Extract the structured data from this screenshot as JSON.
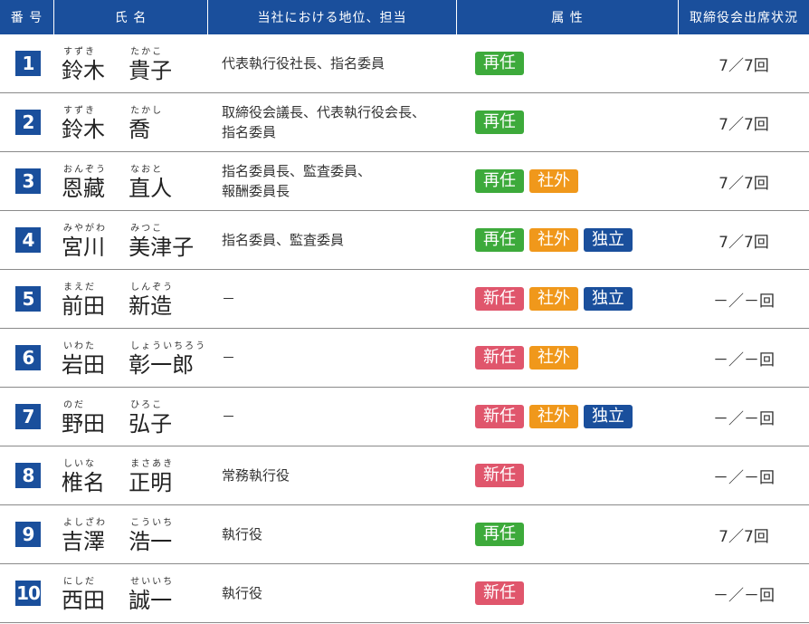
{
  "header": {
    "number": "番 号",
    "name": "氏 名",
    "position": "当社における地位、担当",
    "attributes": "属 性",
    "attendance": "取締役会出席状況"
  },
  "tag_colors": {
    "再任": "#3daa3b",
    "新任": "#e0566c",
    "社外": "#f0981b",
    "独立": "#1a4f9c"
  },
  "rows": [
    {
      "no": "1",
      "family_ruby": "すずき",
      "family": "鈴木",
      "given_ruby": "たかこ",
      "given": "貴子",
      "position": "代表執行役社長、指名委員",
      "tags": [
        "再任"
      ],
      "attendance": "7／7回"
    },
    {
      "no": "2",
      "family_ruby": "すずき",
      "family": "鈴木",
      "given_ruby": "たかし",
      "given": "喬",
      "position": "取締役会議長、代表執行役会長、指名委員",
      "tags": [
        "再任"
      ],
      "attendance": "7／7回"
    },
    {
      "no": "3",
      "family_ruby": "おんぞう",
      "family": "恩藏",
      "given_ruby": "なおと",
      "given": "直人",
      "position": "指名委員長、監査委員、報酬委員長",
      "tags": [
        "再任",
        "社外"
      ],
      "attendance": "7／7回"
    },
    {
      "no": "4",
      "family_ruby": "みやがわ",
      "family": "宮川",
      "given_ruby": "みつこ",
      "given": "美津子",
      "position": "指名委員、監査委員",
      "tags": [
        "再任",
        "社外",
        "独立"
      ],
      "attendance": "7／7回"
    },
    {
      "no": "5",
      "family_ruby": "まえだ",
      "family": "前田",
      "given_ruby": "しんぞう",
      "given": "新造",
      "position": "－",
      "tags": [
        "新任",
        "社外",
        "独立"
      ],
      "attendance": "－／－回"
    },
    {
      "no": "6",
      "family_ruby": "いわた",
      "family": "岩田",
      "given_ruby": "しょういちろう",
      "given": "彰一郎",
      "position": "－",
      "tags": [
        "新任",
        "社外"
      ],
      "attendance": "－／－回"
    },
    {
      "no": "7",
      "family_ruby": "のだ",
      "family": "野田",
      "given_ruby": "ひろこ",
      "given": "弘子",
      "position": "－",
      "tags": [
        "新任",
        "社外",
        "独立"
      ],
      "attendance": "－／－回"
    },
    {
      "no": "8",
      "family_ruby": "しいな",
      "family": "椎名",
      "given_ruby": "まさあき",
      "given": "正明",
      "position": "常務執行役",
      "tags": [
        "新任"
      ],
      "attendance": "－／－回"
    },
    {
      "no": "9",
      "family_ruby": "よしざわ",
      "family": "吉澤",
      "given_ruby": "こういち",
      "given": "浩一",
      "position": "執行役",
      "tags": [
        "再任"
      ],
      "attendance": "7／7回"
    },
    {
      "no": "10",
      "family_ruby": "にしだ",
      "family": "西田",
      "given_ruby": "せいいち",
      "given": "誠一",
      "position": "執行役",
      "tags": [
        "新任"
      ],
      "attendance": "－／－回"
    }
  ]
}
